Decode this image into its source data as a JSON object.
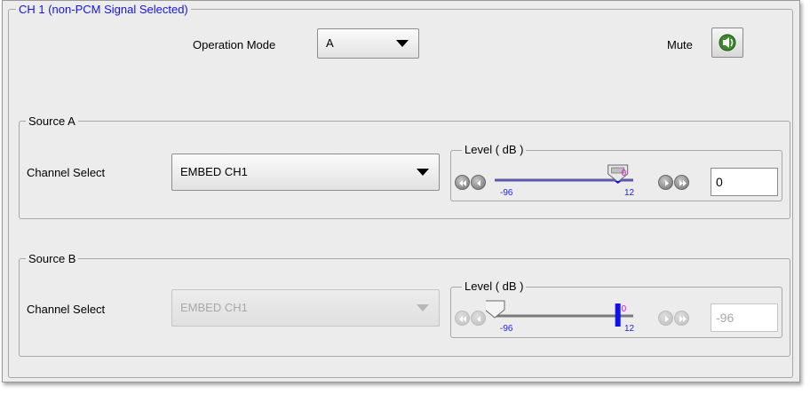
{
  "channel": {
    "title": "CH 1  (non-PCM Signal Selected)",
    "operation_mode_label": "Operation Mode",
    "operation_mode_value": "A",
    "mute_label": "Mute",
    "mute_icon": "speaker-mute-icon"
  },
  "source_a": {
    "title": "Source A",
    "channel_select_label": "Channel Select",
    "channel_select_value": "EMBED CH1",
    "level_title": "Level ( dB )",
    "slider_min_label": "-96",
    "slider_max_label": "12",
    "slider_marker_label": "0",
    "level_value": "0",
    "level_db": 0,
    "enabled": true
  },
  "source_b": {
    "title": "Source B",
    "channel_select_label": "Channel Select",
    "channel_select_value": "EMBED CH1",
    "level_title": "Level ( dB )",
    "slider_min_label": "-96",
    "slider_max_label": "12",
    "slider_marker_label": "0",
    "level_value": "-96",
    "level_db": -96,
    "enabled": false
  },
  "colors": {
    "title_text": "#1414e6",
    "tick_text": "#1e1ee6",
    "marker_text": "#e600e6",
    "marker_bar": "#1010ee",
    "slider_track_active": "#5a5aa8",
    "slider_track_inactive": "#7a7a7a"
  }
}
